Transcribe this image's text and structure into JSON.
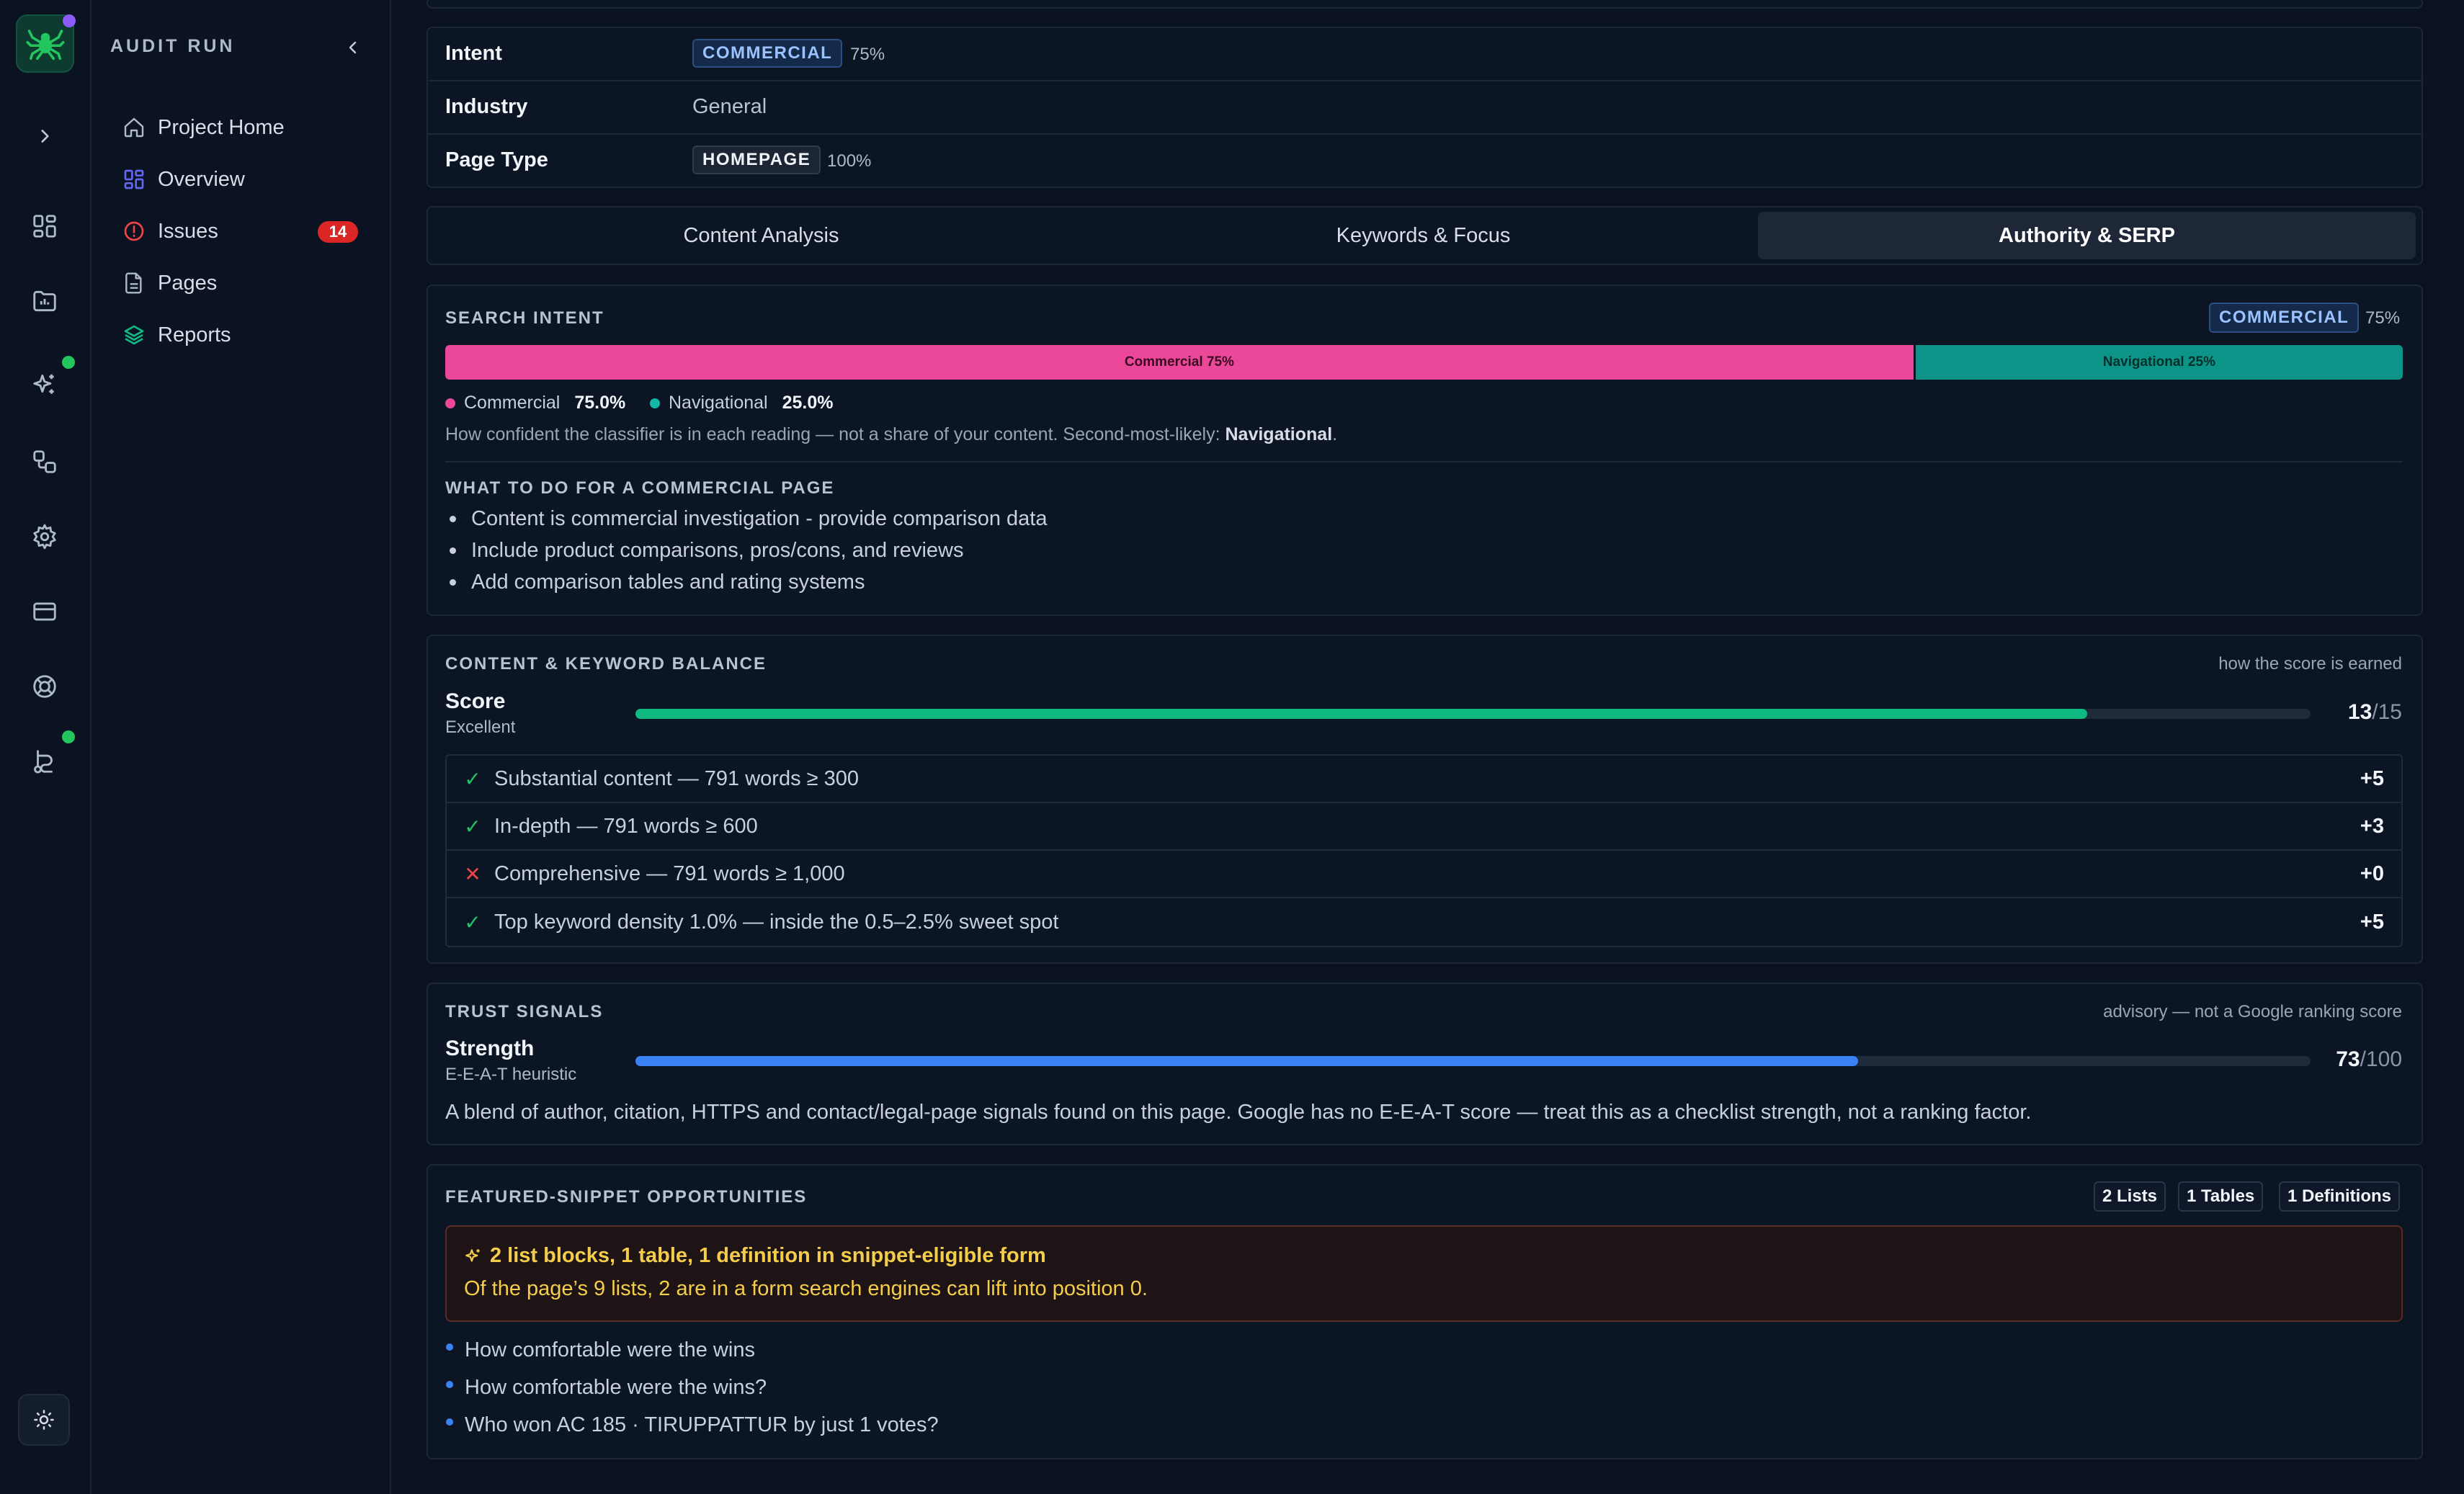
{
  "sidebar": {
    "title": "AUDIT RUN",
    "items": [
      {
        "label": "Project Home"
      },
      {
        "label": "Overview"
      },
      {
        "label": "Issues",
        "badge": "14"
      },
      {
        "label": "Pages"
      },
      {
        "label": "Reports"
      }
    ]
  },
  "details": {
    "intent": {
      "label": "Intent",
      "tag": "COMMERCIAL",
      "percent": "75%"
    },
    "industry": {
      "label": "Industry",
      "value": "General"
    },
    "page_type": {
      "label": "Page Type",
      "tag": "HOMEPAGE",
      "percent": "100%"
    }
  },
  "tabs": [
    {
      "label": "Content Analysis",
      "active": false
    },
    {
      "label": "Keywords & Focus",
      "active": false
    },
    {
      "label": "Authority & SERP",
      "active": true
    }
  ],
  "search_intent": {
    "title": "SEARCH INTENT",
    "tag": "COMMERCIAL",
    "tag_percent": "75%",
    "segments": [
      {
        "label": "Commercial 75%",
        "share": 0.75,
        "color": "#ec4899"
      },
      {
        "label": "Navigational 25%",
        "share": 0.25,
        "color": "#0d9488"
      }
    ],
    "legend": [
      {
        "name": "Commercial",
        "value": "75.0%",
        "color": "#ec4899"
      },
      {
        "name": "Navigational",
        "value": "25.0%",
        "color": "#14b8a6"
      }
    ],
    "note": "How confident the classifier is in each reading — not a share of your content. Second-most-likely:",
    "note_strong": "Navigational",
    "note_end": ".",
    "todo_title": "WHAT TO DO FOR A COMMERCIAL PAGE",
    "todo": [
      "Content is commercial investigation - provide comparison data",
      "Include product comparisons, pros/cons, and reviews",
      "Add comparison tables and rating systems"
    ]
  },
  "balance": {
    "title": "CONTENT & KEYWORD BALANCE",
    "note": "how the score is earned",
    "score_label": "Score",
    "score_sub": "Excellent",
    "score": 13,
    "score_max": "/15",
    "fill_color": "#10b981",
    "checks": [
      {
        "ok": true,
        "text": "Substantial content — 791 words ≥ 300",
        "points": "+5"
      },
      {
        "ok": true,
        "text": "In-depth — 791 words ≥ 600",
        "points": "+3"
      },
      {
        "ok": false,
        "text": "Comprehensive — 791 words ≥ 1,000",
        "points": "+0"
      },
      {
        "ok": true,
        "text": "Top keyword density 1.0% — inside the 0.5–2.5% sweet spot",
        "points": "+5"
      }
    ]
  },
  "trust": {
    "title": "TRUST SIGNALS",
    "note": "advisory — not a Google ranking score",
    "label": "Strength",
    "sub": "E-E-A-T heuristic",
    "score": 73,
    "score_max": "/100",
    "fill_color": "#3b82f6",
    "description": "A blend of author, citation, HTTPS and contact/legal-page signals found on this page. Google has no E-E-A-T score — treat this as a checklist strength, not a ranking factor."
  },
  "snippets": {
    "title": "FEATURED-SNIPPET OPPORTUNITIES",
    "chips": [
      "2 Lists",
      "1 Tables",
      "1 Definitions"
    ],
    "alert_title": "2 list blocks, 1 table, 1 definition in snippet-eligible form",
    "alert_body": "Of the page’s 9 lists, 2 are in a form search engines can lift into position 0.",
    "items": [
      "How comfortable were the wins",
      "How comfortable were the wins?",
      "Who won AC 185 · TIRUPPATTUR by just 1 votes?"
    ]
  }
}
